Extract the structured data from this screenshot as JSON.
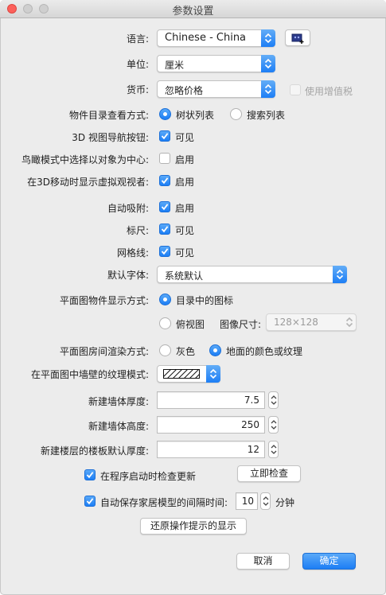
{
  "window": {
    "title": "参数设置"
  },
  "language": {
    "label": "语言:",
    "value": "Chinese - China"
  },
  "unit": {
    "label": "单位:",
    "value": "厘米"
  },
  "currency": {
    "label": "货币:",
    "value": "忽略价格",
    "vat_label": "使用增值税"
  },
  "catalog_view": {
    "label": "物件目录查看方式:",
    "option_tree": "树状列表",
    "option_search": "搜索列表"
  },
  "nav_arrows": {
    "label": "3D 视图导航按钮:",
    "text": "可见"
  },
  "aerial_center": {
    "label": "鸟瞰模式中选择以对象为中心:",
    "text": "启用"
  },
  "virtual_visitor": {
    "label": "在3D移动时显示虚拟观视者:",
    "text": "启用"
  },
  "magnetism": {
    "label": "自动吸附:",
    "text": "启用"
  },
  "rulers": {
    "label": "标尺:",
    "text": "可见"
  },
  "grid": {
    "label": "网格线:",
    "text": "可见"
  },
  "default_font": {
    "label": "默认字体:",
    "value": "系统默认"
  },
  "plan_furniture": {
    "label": "平面图物件显示方式:",
    "option_catalog": "目录中的图标",
    "option_top": "俯视图",
    "icon_size_label": "图像尺寸:",
    "icon_size_value": "128×128"
  },
  "room_render": {
    "label": "平面图房间渲染方式:",
    "option_gray": "灰色",
    "option_floor": "地面的颜色或纹理"
  },
  "wall_pattern": {
    "label": "在平面图中墙壁的纹理模式:"
  },
  "wall_thickness": {
    "label": "新建墙体厚度:",
    "value": "7.5"
  },
  "wall_height": {
    "label": "新建墙体高度:",
    "value": "250"
  },
  "floor_thickness": {
    "label": "新建楼层的楼板默认厚度:",
    "value": "12"
  },
  "updates": {
    "text": "在程序启动时检查更新",
    "button": "立即检查"
  },
  "autosave": {
    "text": "自动保存家居模型的间隔时间:",
    "value": "10",
    "unit": "分钟"
  },
  "restore_tips": {
    "button": "还原操作提示的显示"
  },
  "footer": {
    "cancel": "取消",
    "ok": "确定"
  },
  "colors": {
    "accent": "#1d7ef5",
    "window_bg": "#ececec",
    "close": "#fc605b"
  },
  "icons": [
    "language-library-icon",
    "checkmark-icon",
    "updown-arrows-icon",
    "hatch-pattern-icon"
  ]
}
